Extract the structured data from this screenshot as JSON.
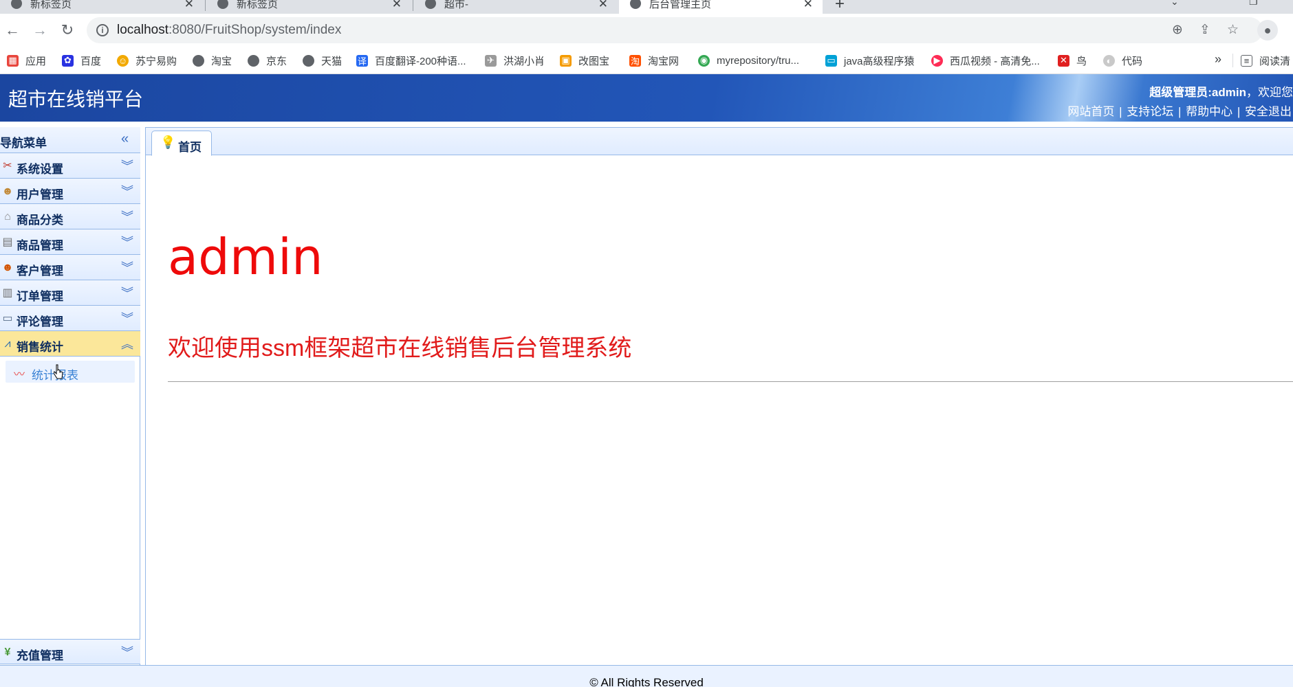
{
  "browser": {
    "tabs": [
      {
        "title": "新标签页",
        "active": false
      },
      {
        "title": "新标签页",
        "active": false
      },
      {
        "title": "超市-",
        "active": false
      },
      {
        "title": "后台管理主页",
        "active": true
      }
    ],
    "new_tab": "+",
    "address": {
      "host": "localhost",
      "path": ":8080/FruitShop/system/index"
    },
    "bookmarks": [
      {
        "label": "应用",
        "icon": "apps-grid-icon",
        "color": "#e8453c"
      },
      {
        "label": "百度",
        "icon": "baidu-paw-icon",
        "color": "#2932e1"
      },
      {
        "label": "苏宁易购",
        "icon": "suning-icon",
        "color": "#f2a900"
      },
      {
        "label": "淘宝",
        "icon": "globe-icon",
        "color": "#5f6368"
      },
      {
        "label": "京东",
        "icon": "globe-icon",
        "color": "#5f6368"
      },
      {
        "label": "天猫",
        "icon": "globe-icon",
        "color": "#5f6368"
      },
      {
        "label": "百度翻译-200种语...",
        "icon": "translate-icon",
        "color": "#2468f2"
      },
      {
        "label": "洪湖小肖",
        "icon": "bird-icon",
        "color": "#7a7a7a"
      },
      {
        "label": "改图宝",
        "icon": "gaitubao-icon",
        "color": "#f59b00"
      },
      {
        "label": "淘宝网",
        "icon": "taobao-icon",
        "color": "#ff5000"
      },
      {
        "label": "myrepository/tru...",
        "icon": "chrome-icon",
        "color": "#34a853"
      },
      {
        "label": "java高级程序猿",
        "icon": "bilibili-icon",
        "color": "#00a1d6"
      },
      {
        "label": "西瓜视频 - 高清免...",
        "icon": "xigua-icon",
        "color": "#fe2c55"
      },
      {
        "label": "鸟",
        "icon": "bird-red-icon",
        "color": "#e02020"
      },
      {
        "label": "代码",
        "icon": "leaf-icon",
        "color": "#c9c9c9"
      }
    ],
    "bookmarks_more": "»",
    "reading_list": "阅读清"
  },
  "header": {
    "title": "超市在线销平台",
    "user_role": "超级管理员:admin",
    "user_suffix": "，欢迎您",
    "links": [
      "网站首页",
      "支持论坛",
      "帮助中心",
      "安全退出"
    ]
  },
  "sidebar": {
    "title": "导航菜单",
    "items": [
      {
        "label": "系统设置",
        "icon": "tools-icon"
      },
      {
        "label": "用户管理",
        "icon": "users-icon"
      },
      {
        "label": "商品分类",
        "icon": "category-icon"
      },
      {
        "label": "商品管理",
        "icon": "goods-icon"
      },
      {
        "label": "客户管理",
        "icon": "customers-icon"
      },
      {
        "label": "订单管理",
        "icon": "orders-icon"
      },
      {
        "label": "评论管理",
        "icon": "comment-icon"
      },
      {
        "label": "销售统计",
        "icon": "stats-icon",
        "active": true
      }
    ],
    "sub_item": {
      "label": "统计报表"
    },
    "bottom_item": {
      "label": "充值管理",
      "icon": "yen-icon"
    }
  },
  "main": {
    "tab_label": "首页",
    "heading": "admin",
    "welcome": "欢迎使用ssm框架超市在线销售后台管理系统"
  },
  "footer": {
    "text": "© All Rights Reserved"
  },
  "colors": {
    "header_blue": "#2256b8",
    "accent_red": "#ee0a0a",
    "menu_border": "#95b8e7",
    "active_menu": "#fbe79a"
  }
}
